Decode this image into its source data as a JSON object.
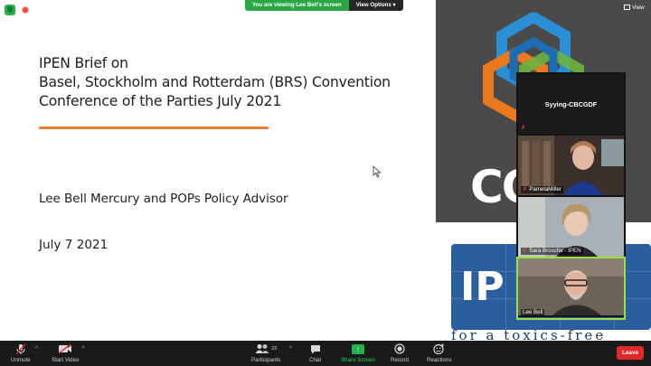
{
  "top_bar": {
    "share_status": "You are viewing Lee Bell's screen",
    "view_options_label": "View Options",
    "view_options_icon": "chevron-down-icon",
    "view_label": "View"
  },
  "slide": {
    "title_lines": [
      "IPEN Brief on",
      "Basel, Stockholm and Rotterdam (BRS) Convention",
      "Conference of the Parties  July 2021"
    ],
    "presenter": "Lee Bell Mercury and POPs Policy Advisor",
    "date": "July 7 2021",
    "side_big_text": "CO",
    "side_blue_text": "IP",
    "side_bottom_text": "for a toxics-free future",
    "accent_color": "#ed7d31"
  },
  "participants": [
    {
      "name": "Syying-CBCGDF",
      "video": false,
      "muted": true
    },
    {
      "name": "PamelaMiller",
      "video": true,
      "muted": true
    },
    {
      "name": "Sara Brosche - IPEN",
      "video": true,
      "muted": true
    },
    {
      "name": "Lee Bell",
      "video": true,
      "muted": false,
      "active_speaker": true
    }
  ],
  "toolbar": {
    "unmute": "Unmute",
    "start_video": "Start Video",
    "participants": "Participants",
    "participant_count": "23",
    "chat": "Chat",
    "share_screen": "Share Screen",
    "record": "Record",
    "reactions": "Reactions",
    "leave": "Leave"
  },
  "colors": {
    "share_green": "#29a745",
    "leave_red": "#e02828",
    "active_speaker": "#9bde3f"
  }
}
